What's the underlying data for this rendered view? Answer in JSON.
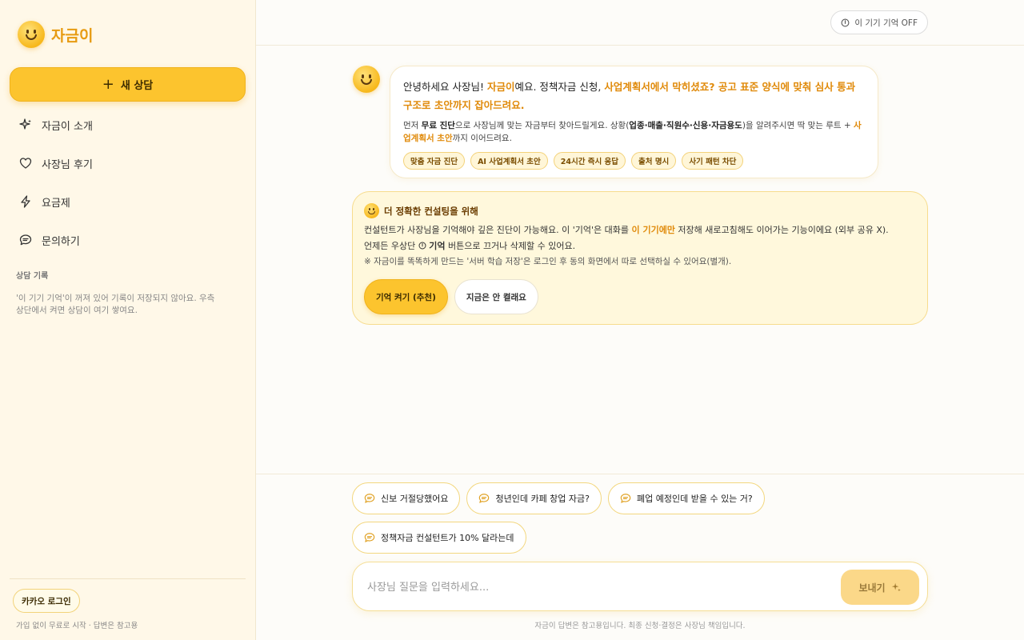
{
  "brand": {
    "name": "자금이"
  },
  "sidebar": {
    "new_chat_label": "새 상담",
    "items": [
      {
        "label": "자금이 소개",
        "icon": "sparkle-icon"
      },
      {
        "label": "사장님 후기",
        "icon": "heart-icon"
      },
      {
        "label": "요금제",
        "icon": "bolt-icon"
      },
      {
        "label": "문의하기",
        "icon": "chat-icon"
      }
    ],
    "history_title": "상담 기록",
    "history_empty": "'이 기기 기억'이 꺼져 있어 기록이 저장되지 않아요. 우측 상단에서 켜면 상담이 여기 쌓여요.",
    "kakao_login": "카카오 로그인",
    "footer": "가입 없이 무료로 시작 · 답변은 참고용"
  },
  "topbar": {
    "memory_toggle": "이 기기 기억 OFF"
  },
  "greeting": {
    "lead_1": "안녕하세요 사장님! ",
    "lead_brand": "자금이",
    "lead_2": "예요. 정책자금 신청, ",
    "lead_highlight": "사업계획서에서 막히셨죠? 공고 표준 양식에 맞춰 심사 통과 구조로 초안까지 잡아드려요.",
    "sub_1": "먼저 ",
    "sub_b1": "무료 진단",
    "sub_2": "으로 사장님께 맞는 자금부터 찾아드릴게요. 상황(",
    "sub_b2": "업종·매출·직원수·신용·자금용도",
    "sub_3": ")을 알려주시면 딱 맞는 루트 + ",
    "sub_b3": "사업계획서 초안",
    "sub_4": "까지 이어드려요.",
    "chips": [
      "맞춤 자금 진단",
      "AI 사업계획서 초안",
      "24시간 즉시 응답",
      "출처 명시",
      "사기 패턴 차단"
    ]
  },
  "consult": {
    "title": "더 정확한 컨설팅을 위해",
    "line1_a": "컨설턴트가 사장님을 기억해야 깊은 진단이 가능해요. 이 '기억'은 대화를 ",
    "line1_b": "이 기기에만",
    "line1_c": " 저장해 새로고침해도 이어가는 기능이에요 (외부 공유 X).",
    "line2_a": "언제든 우상단 ",
    "line2_b": "기억",
    "line2_c": " 버튼으로 끄거나 삭제할 수 있어요.",
    "line3": "※ 자금이를 똑똑하게 만드는 '서버 학습 저장'은 로그인 후 동의 화면에서 따로 선택하실 수 있어요(별개).",
    "btn_on": "기억 켜기 (추천)",
    "btn_off": "지금은 안 켤래요"
  },
  "suggestions": [
    "신보 거절당했어요",
    "청년인데 카페 창업 자금?",
    "폐업 예정인데 받을 수 있는 거?",
    "정책자금 컨설턴트가 10% 달라는데"
  ],
  "composer": {
    "placeholder": "사장님 질문을 입력하세요...",
    "send_label": "보내기"
  },
  "footnote": "자금이 답변은 참고용입니다. 최종 신청·결정은 사장님 책임입니다."
}
